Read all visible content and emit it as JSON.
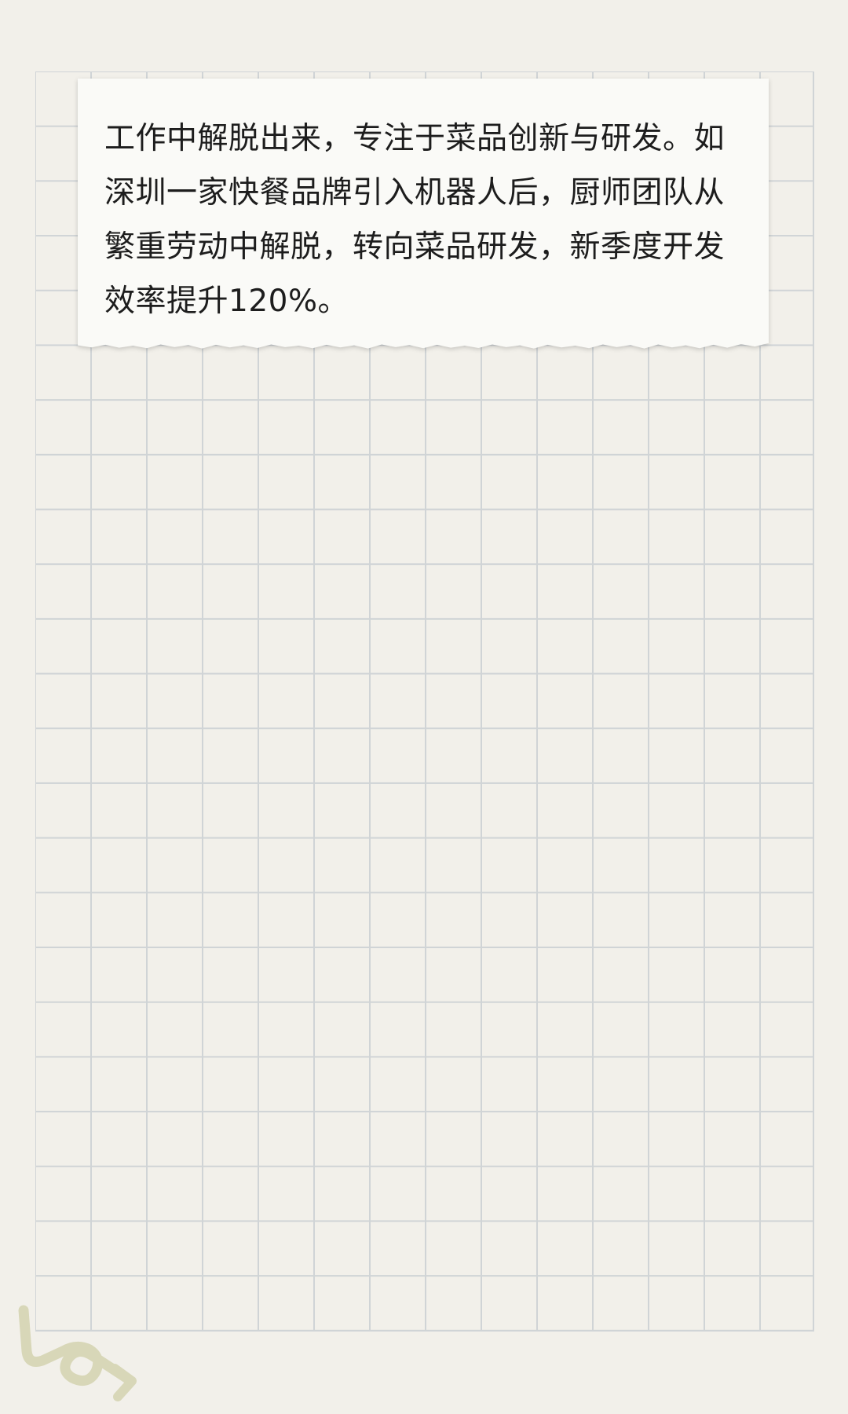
{
  "note": {
    "text": "工作中解脱出来，专注于菜品创新与研发。如深圳一家快餐品牌引入机器人后，厨师团队从繁重劳动中解脱，转向菜品研发，新季度开发效率提升120%。"
  },
  "colors": {
    "background": "#f2f0ea",
    "grid_line": "#d0d4d6",
    "note_paper": "#fafaf7",
    "text": "#1d1d1d",
    "doodle": "#d8d7b8"
  },
  "decorations": {
    "corner_doodle": "scribble-arrow-icon"
  }
}
